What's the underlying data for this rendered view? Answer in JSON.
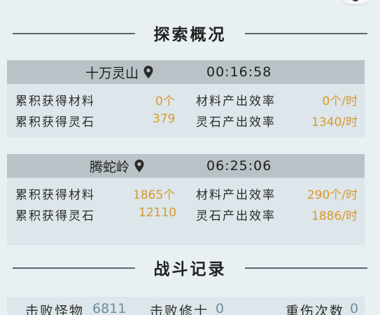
{
  "explore": {
    "title": "探索概况",
    "locations": [
      {
        "name": "十万灵山",
        "time": "00:16:58",
        "rows": [
          {
            "label1": "累积获得材料",
            "value1": "0个",
            "label2": "材料产出效率",
            "value2": "0个/时"
          },
          {
            "label1": "累积获得灵石",
            "value1": "379",
            "label2": "灵石产出效率",
            "value2": "1340/时"
          }
        ]
      },
      {
        "name": "腾蛇岭",
        "time": "06:25:06",
        "rows": [
          {
            "label1": "累积获得材料",
            "value1": "1865个",
            "label2": "材料产出效率",
            "value2": "290个/时"
          },
          {
            "label1": "累积获得灵石",
            "value1": "12110",
            "label2": "灵石产出效率",
            "value2": "1886/时"
          }
        ]
      }
    ]
  },
  "battle": {
    "title": "战斗记录",
    "stats": [
      {
        "label": "击败怪物",
        "value": "6811"
      },
      {
        "label": "击败修士",
        "value": "0"
      },
      {
        "label": "重伤次数",
        "value": "0"
      }
    ]
  },
  "icons": {
    "location": "location-pin-icon"
  },
  "colors": {
    "value": "#d9992b",
    "stat": "#6a8f9c",
    "header_bar": "#b9c2c6"
  }
}
